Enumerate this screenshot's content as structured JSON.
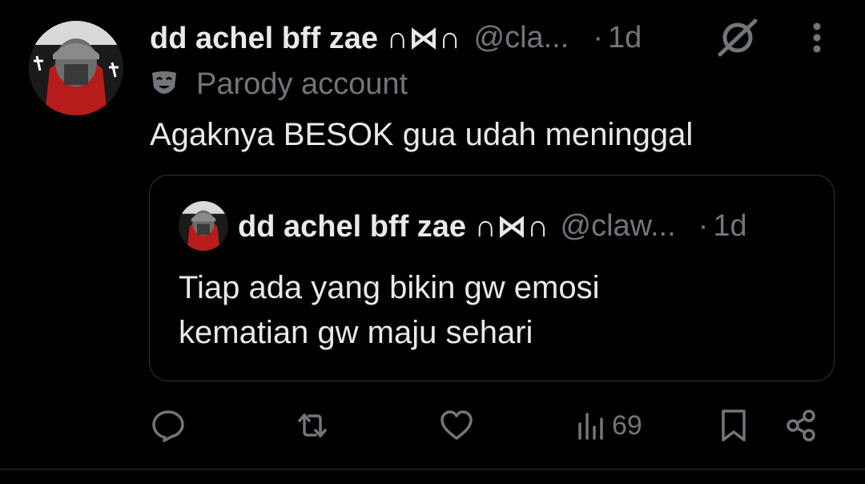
{
  "post": {
    "author": {
      "display_name": "dd achel bff zae ∩⋈∩",
      "handle": "@cla...",
      "avatar_icon": "avatar-image"
    },
    "time": "1d",
    "time_separator": "·",
    "parody_label": "Parody account",
    "text": "Agaknya BESOK gua udah meninggal"
  },
  "quote": {
    "author": {
      "display_name": "dd achel bff zae ∩⋈∩",
      "handle": "@claw...",
      "avatar_icon": "avatar-image"
    },
    "time": "1d",
    "time_separator": "·",
    "text_line1": "Tiap ada yang bikin gw emosi",
    "text_line2": "kematian gw maju sehari"
  },
  "actions": {
    "views_count": "69",
    "icons": [
      "reply-icon",
      "repost-icon",
      "like-icon",
      "views-icon",
      "bookmark-icon",
      "share-icon"
    ]
  },
  "colors": {
    "background": "#000000",
    "text_primary": "#e7e9ea",
    "text_secondary": "#71767b",
    "border": "#2f3336"
  }
}
